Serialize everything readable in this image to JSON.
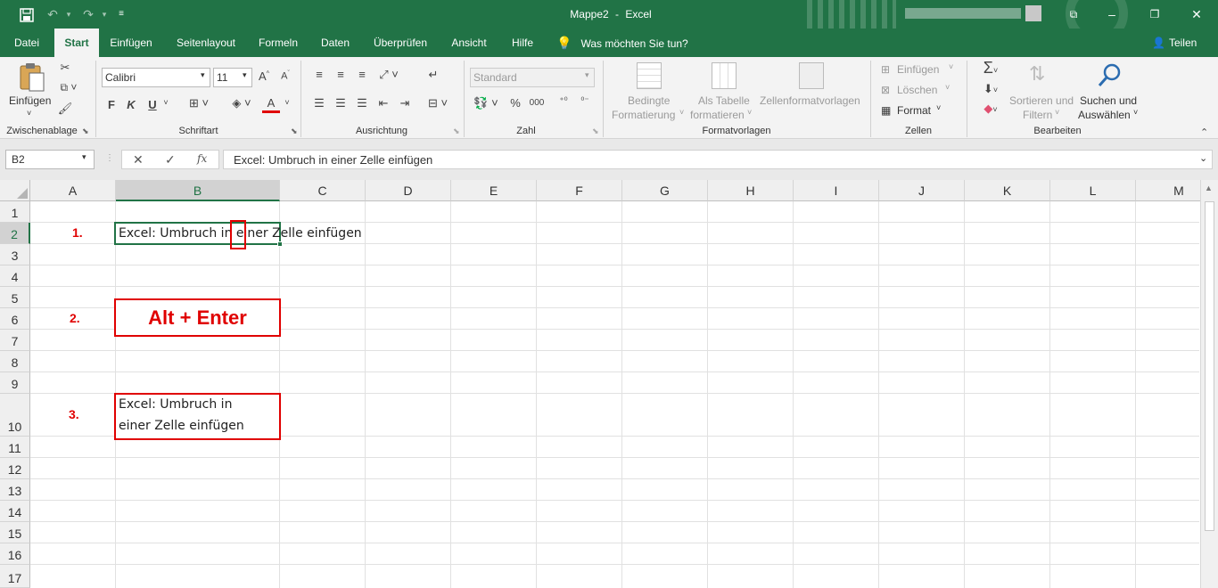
{
  "titlebar": {
    "title": "Mappe2",
    "separator": "-",
    "app": "Excel"
  },
  "menu": {
    "tabs": [
      "Datei",
      "Start",
      "Einfügen",
      "Seitenlayout",
      "Formeln",
      "Daten",
      "Überprüfen",
      "Ansicht",
      "Hilfe"
    ],
    "active_tab": "Start",
    "tellme": "Was möchten Sie tun?",
    "share": "Teilen"
  },
  "ribbon": {
    "clipboard": {
      "paste": "Einfügen",
      "group": "Zwischenablage"
    },
    "font": {
      "name": "Calibri",
      "size": "11",
      "bold": "F",
      "italic": "K",
      "underline": "U",
      "font_color_glyph": "A",
      "group": "Schriftart"
    },
    "alignment": {
      "group": "Ausrichtung"
    },
    "number": {
      "format": "Standard",
      "percent": "%",
      "thousands": "000",
      "group": "Zahl"
    },
    "styles": {
      "conditional_1": "Bedingte",
      "conditional_2": "Formatierung",
      "table_1": "Als Tabelle",
      "table_2": "formatieren",
      "cellstyles": "Zellenformatvorlagen",
      "group": "Formatvorlagen"
    },
    "cells": {
      "insert": "Einfügen",
      "delete": "Löschen",
      "format": "Format",
      "group": "Zellen"
    },
    "editing": {
      "sort_1": "Sortieren und",
      "sort_2": "Filtern",
      "find_1": "Suchen und",
      "find_2": "Auswählen",
      "group": "Bearbeiten"
    }
  },
  "formula_bar": {
    "name_box": "B2",
    "fx": "fx",
    "content": "Excel: Umbruch in einer Zelle einfügen"
  },
  "sheet": {
    "columns": [
      "A",
      "B",
      "C",
      "D",
      "E",
      "F",
      "G",
      "H",
      "I",
      "J",
      "K",
      "L",
      "M"
    ],
    "rows": [
      "1",
      "2",
      "3",
      "4",
      "5",
      "6",
      "7",
      "8",
      "9",
      "10",
      "11",
      "12",
      "13",
      "14",
      "15",
      "16",
      "17"
    ],
    "active_cell": "B2",
    "b2_text": "Excel: Umbruch in einer Zelle einfügen",
    "b10_line1": "Excel: Umbruch in",
    "b10_line2": "einer Zelle einfügen"
  },
  "annotations": {
    "step1": "1.",
    "step2": "2.",
    "step3": "3.",
    "shortcut": "Alt + Enter",
    "color": "#e00000"
  },
  "colors": {
    "excel_green": "#217346",
    "ribbon_bg": "#f3f3f3"
  }
}
